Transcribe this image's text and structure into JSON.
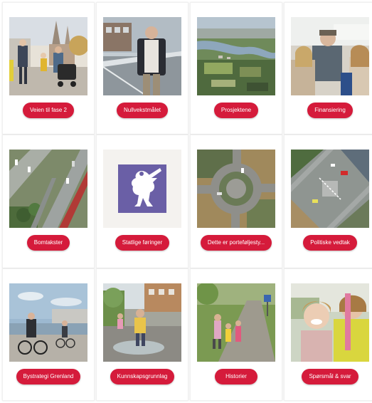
{
  "accent_color": "#d51b3b",
  "cards": [
    {
      "label": "Veien til fase 2",
      "image": "family-with-stroller-photo"
    },
    {
      "label": "Nullvekstmålet",
      "image": "man-on-phone-bridge-photo"
    },
    {
      "label": "Prosjektene",
      "image": "aerial-river-valley-photo"
    },
    {
      "label": "Finansiering",
      "image": "bus-passengers-photo"
    },
    {
      "label": "Bomtakster",
      "image": "aerial-highway-photo"
    },
    {
      "label": "Statlige føringer",
      "image": "coat-of-arms-lion-logo"
    },
    {
      "label": "Dette er porteføljesty...",
      "image": "aerial-roundabout-photo"
    },
    {
      "label": "Politiske vedtak",
      "image": "aerial-intersection-photo"
    },
    {
      "label": "Bystrategi Grenland",
      "image": "cyclists-waterfront-photo"
    },
    {
      "label": "Kunnskapsgrunnlag",
      "image": "child-splashing-puddle-photo"
    },
    {
      "label": "Historier",
      "image": "family-walking-path-photo"
    },
    {
      "label": "Spørsmål & svar",
      "image": "smiling-children-photo"
    }
  ]
}
